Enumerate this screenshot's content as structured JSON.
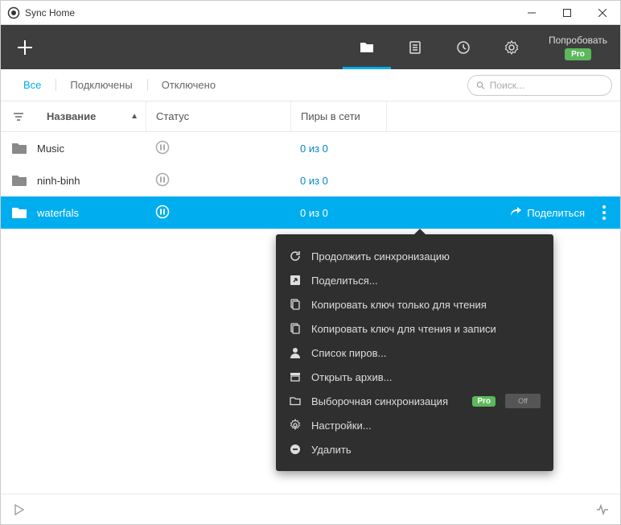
{
  "window": {
    "title": "Sync Home"
  },
  "toolbar": {
    "try_label": "Попробовать",
    "pro_badge": "Pro"
  },
  "filters": {
    "all": "Все",
    "connected": "Подключены",
    "disconnected": "Отключено",
    "search_placeholder": "Поиск..."
  },
  "columns": {
    "name": "Название",
    "status": "Статус",
    "peers": "Пиры в сети"
  },
  "rows": [
    {
      "name": "Music",
      "peers": "0 из 0",
      "selected": false
    },
    {
      "name": "ninh-binh",
      "peers": "0 из 0",
      "selected": false
    },
    {
      "name": "waterfals",
      "peers": "0 из 0",
      "selected": true
    }
  ],
  "row_actions": {
    "share": "Поделиться"
  },
  "menu": {
    "resume": "Продолжить синхронизацию",
    "share": "Поделиться...",
    "copy_ro": "Копировать ключ только для чтения",
    "copy_rw": "Копировать ключ для чтения и записи",
    "peers": "Список пиров...",
    "archive": "Открыть архив...",
    "selective": "Выборочная синхронизация",
    "selective_badge": "Pro",
    "selective_toggle": "Off",
    "settings": "Настройки...",
    "delete": "Удалить"
  }
}
